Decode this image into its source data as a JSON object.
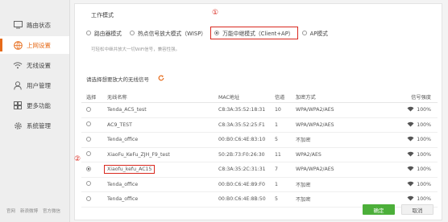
{
  "sidebar": {
    "items": [
      {
        "label": "路由状态",
        "icon": "monitor-icon"
      },
      {
        "label": "上网设置",
        "icon": "globe-icon",
        "active": true
      },
      {
        "label": "无线设置",
        "icon": "wifi-icon"
      },
      {
        "label": "用户管理",
        "icon": "user-icon"
      },
      {
        "label": "更多功能",
        "icon": "grid-icon"
      },
      {
        "label": "系统管理",
        "icon": "gear-icon"
      }
    ],
    "footer": [
      "官网",
      "新浪微博",
      "官方微信"
    ]
  },
  "mode": {
    "title": "工作模式",
    "options": [
      {
        "label": "路由器模式",
        "checked": false
      },
      {
        "label": "热点信号放大模式（WISP）",
        "checked": false
      },
      {
        "label": "万能中继模式（Client+AP）",
        "checked": true
      },
      {
        "label": "AP模式",
        "checked": false
      }
    ],
    "hint": "可轻松中继并放大一切WiFi信号，兼容性强。",
    "annotation": "①"
  },
  "scan": {
    "title": "请选择想要放大的无线信号",
    "annotation": "②"
  },
  "table": {
    "headers": [
      "选择",
      "无线名称",
      "MAC地址",
      "信道",
      "加密方式",
      "信号强度"
    ],
    "rows": [
      {
        "name": "Tenda_AC5_test",
        "mac": "C8:3A:35:52:18:31",
        "channel": "10",
        "enc": "WPA/WPA2/AES",
        "signal": "100%"
      },
      {
        "name": "AC9_TEST",
        "mac": "C8:3A:35:52:25:F1",
        "channel": "1",
        "enc": "WPA/WPA2/AES",
        "signal": "100%"
      },
      {
        "name": "Tenda_office",
        "mac": "00:B0:C6:4E:83:10",
        "channel": "5",
        "enc": "不加密",
        "signal": "100%"
      },
      {
        "name": "XiaoFu_KeFu_ZJH_F9_test",
        "mac": "50:2B:73:F0:26:30",
        "channel": "11",
        "enc": "WPA2/AES",
        "signal": "100%"
      },
      {
        "name": "Xiaofu_kefu_AC15",
        "mac": "C8:3A:35:2C:31:31",
        "channel": "7",
        "enc": "WPA/WPA2/AES",
        "signal": "100%",
        "selected": true
      },
      {
        "name": "Tenda_office",
        "mac": "00:B0:C6:4E:89:F0",
        "channel": "1",
        "enc": "不加密",
        "signal": "100%"
      },
      {
        "name": "Tenda_office",
        "mac": "00:B0:C6:4E:8B:50",
        "channel": "5",
        "enc": "不加密",
        "signal": "100%"
      }
    ]
  },
  "buttons": {
    "ok": "确定",
    "cancel": "取消"
  },
  "colors": {
    "accent": "#e66b1a",
    "annotation": "#d9281e",
    "ok": "#4caf3a"
  }
}
